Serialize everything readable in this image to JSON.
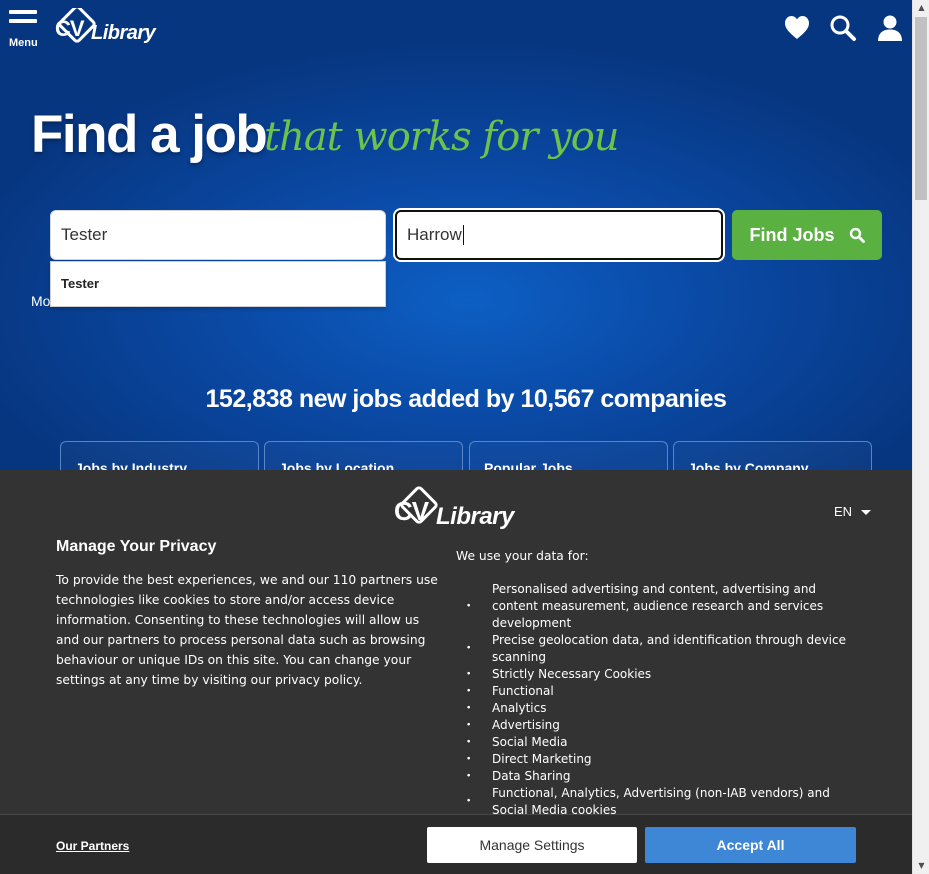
{
  "nav": {
    "menu_label": "Menu",
    "logo_icon": "cv-library-logo",
    "icons": [
      "heart-icon",
      "search-icon",
      "user-icon"
    ]
  },
  "hero": {
    "headline": "Find a job",
    "tagline": "that works for you"
  },
  "search": {
    "keyword_value": "Tester",
    "location_value": "Harrow",
    "button_label": "Find Jobs",
    "suggestions": [
      "Tester"
    ],
    "more_link_label": "Mo"
  },
  "stats_text": "152,838 new jobs added by 10,567 companies",
  "categories": [
    "Jobs by Industry",
    "Jobs by Location",
    "Popular Jobs",
    "Jobs by Company"
  ],
  "privacy": {
    "title": "Manage Your Privacy",
    "language": "EN",
    "body": "To provide the best experiences, we and our 110 partners use technologies like cookies to store and/or access device information. Consenting to these technologies will allow us and our partners to process personal data such as browsing behaviour or unique IDs on this site. You can change your settings at any time by visiting our privacy policy.",
    "use_title": "We use your data for:",
    "purposes": [
      "Personalised advertising and content, advertising and content measurement, audience research and services development",
      "Precise geolocation data, and identification through device scanning",
      "Strictly Necessary Cookies",
      "Functional",
      "Analytics",
      "Advertising",
      "Social Media",
      "Direct Marketing",
      "Data Sharing",
      "Functional, Analytics, Advertising (non-IAB vendors) and Social Media cookies"
    ],
    "partners_label": "Our Partners",
    "manage_label": "Manage Settings",
    "accept_label": "Accept All"
  },
  "colors": {
    "accent_green": "#5ab141",
    "tagline_green": "#6cc24a",
    "accept_blue": "#3e86d6",
    "panel": "#333333"
  }
}
